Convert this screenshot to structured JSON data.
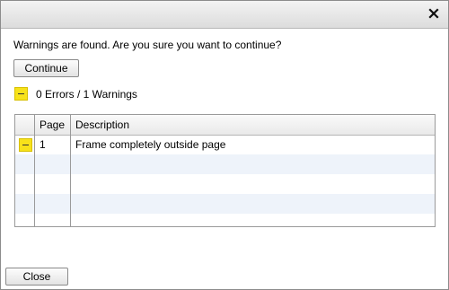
{
  "dialog": {
    "close_icon": "close-icon",
    "message": "Warnings are found. Are you sure you want to continue?",
    "continue_label": "Continue",
    "summary": "0 Errors / 1 Warnings",
    "close_label": "Close"
  },
  "table": {
    "columns": [
      "",
      "Page",
      "Description"
    ],
    "rows": [
      {
        "icon": "warning-icon",
        "page": "1",
        "description": "Frame completely outside page"
      }
    ]
  },
  "colors": {
    "warning": "#f7e21a",
    "alt_row": "#eef3fa"
  }
}
